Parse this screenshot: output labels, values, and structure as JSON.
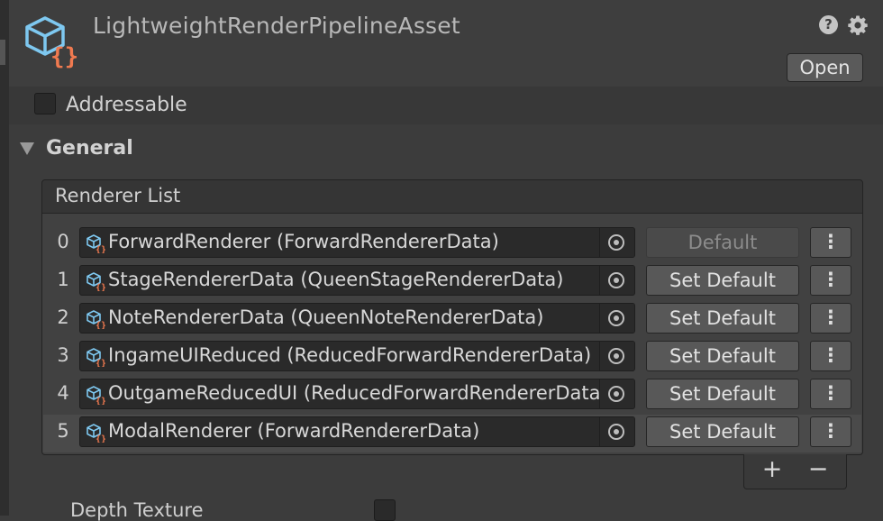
{
  "header": {
    "title": "LightweightRenderPipelineAsset",
    "open_label": "Open",
    "help_icon": "?"
  },
  "addressable": {
    "label": "Addressable",
    "checked": false
  },
  "general": {
    "label": "General",
    "expanded": true
  },
  "renderer_list": {
    "header": "Renderer List",
    "rows": [
      {
        "index": "0",
        "value": "ForwardRenderer (ForwardRendererData)",
        "button": "Default",
        "is_default": true,
        "more": "⋮"
      },
      {
        "index": "1",
        "value": "StageRendererData (QueenStageRendererData)",
        "button": "Set Default",
        "is_default": false,
        "more": "⋮"
      },
      {
        "index": "2",
        "value": "NoteRendererData (QueenNoteRendererData)",
        "button": "Set Default",
        "is_default": false,
        "more": "⋮"
      },
      {
        "index": "3",
        "value": "IngameUIReduced (ReducedForwardRendererData)",
        "button": "Set Default",
        "is_default": false,
        "more": "⋮"
      },
      {
        "index": "4",
        "value": "OutgameReducedUI (ReducedForwardRendererData)",
        "button": "Set Default",
        "is_default": false,
        "more": "⋮"
      },
      {
        "index": "5",
        "value": "ModalRenderer (ForwardRendererData)",
        "button": "Set Default",
        "is_default": false,
        "more": "⋮"
      }
    ],
    "add_label": "+",
    "remove_label": "−"
  },
  "depth_texture": {
    "label": "Depth Texture",
    "checked": false
  },
  "colors": {
    "background": "#3c3c3c",
    "asset_icon_blue": "#7ec8f0",
    "asset_icon_orange": "#f07a50"
  }
}
